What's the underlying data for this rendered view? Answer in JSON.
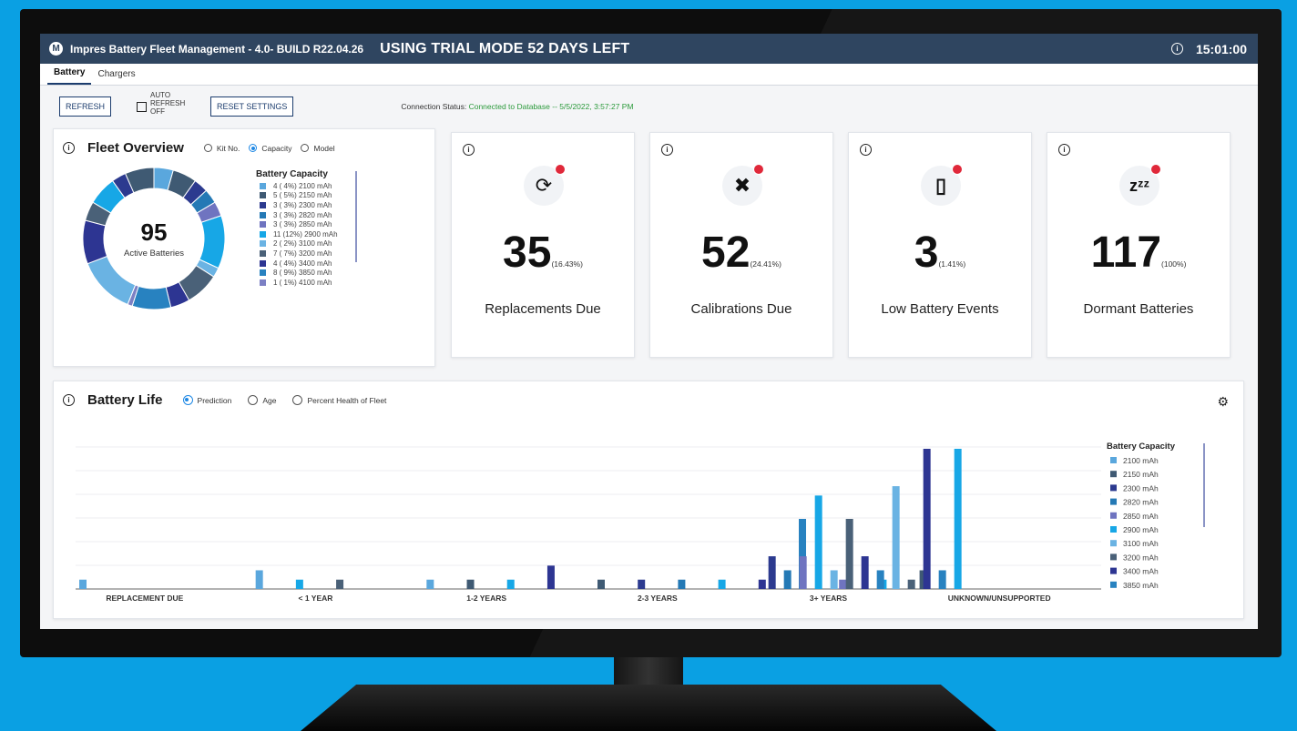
{
  "titlebar": {
    "app_title": "Impres Battery Fleet Management - 4.0- BUILD R22.04.26",
    "trial_text": "USING TRIAL MODE 52 DAYS LEFT",
    "clock": "15:01:00",
    "logo_glyph": "M"
  },
  "tabs": [
    {
      "label": "Battery",
      "active": true
    },
    {
      "label": "Chargers",
      "active": false
    }
  ],
  "toolbar": {
    "refresh_label": "REFRESH",
    "auto_refresh_label": "AUTO REFRESH",
    "auto_refresh_state": "OFF",
    "auto_refresh_checked": false,
    "reset_label": "RESET SETTINGS",
    "connection_label": "Connection Status:",
    "connection_value": "Connected to Database -- 5/5/2022, 3:57:27 PM"
  },
  "fleet_overview": {
    "title": "Fleet Overview",
    "options": [
      "Kit No.",
      "Capacity",
      "Model"
    ],
    "selected_option": "Capacity",
    "total": "95",
    "total_label": "Active Batteries",
    "legend_title": "Battery Capacity",
    "legend": [
      {
        "text": "4 (  4%) 2100 mAh",
        "count": 4,
        "color": "#5aa7dd"
      },
      {
        "text": "5 (  5%) 2150 mAh",
        "count": 5,
        "color": "#3f5a73"
      },
      {
        "text": "3 (  3%) 2300 mAh",
        "count": 3,
        "color": "#2c3a8f"
      },
      {
        "text": "3 (  3%) 2820 mAh",
        "count": 3,
        "color": "#2479b5"
      },
      {
        "text": "3 (  3%) 2850 mAh",
        "count": 3,
        "color": "#6f74c0"
      },
      {
        "text": "11 (12%) 2900 mAh",
        "count": 11,
        "color": "#17a7e6"
      },
      {
        "text": "2 (  2%) 3100 mAh",
        "count": 2,
        "color": "#6ab3e3"
      },
      {
        "text": "7 (  7%) 3200 mAh",
        "count": 7,
        "color": "#4a6178"
      },
      {
        "text": "4 (  4%) 3400 mAh",
        "count": 4,
        "color": "#2d3592"
      },
      {
        "text": "8 (  9%) 3850 mAh",
        "count": 8,
        "color": "#2882c0"
      },
      {
        "text": "1 (  1%) 4100 mAh",
        "count": 1,
        "color": "#7c80c4"
      }
    ],
    "donut_segments": [
      {
        "value": 4,
        "color": "#5aa7dd"
      },
      {
        "value": 5,
        "color": "#3f5a73"
      },
      {
        "value": 3,
        "color": "#2c3a8f"
      },
      {
        "value": 3,
        "color": "#2479b5"
      },
      {
        "value": 3,
        "color": "#6f74c0"
      },
      {
        "value": 11,
        "color": "#17a7e6"
      },
      {
        "value": 2,
        "color": "#6ab3e3"
      },
      {
        "value": 7,
        "color": "#4a6178"
      },
      {
        "value": 4,
        "color": "#2d3592"
      },
      {
        "value": 8,
        "color": "#2882c0"
      },
      {
        "value": 1,
        "color": "#7c80c4"
      },
      {
        "value": 12,
        "color": "#6ab3e3"
      },
      {
        "value": 9,
        "color": "#2d3592"
      },
      {
        "value": 4,
        "color": "#4a6178"
      },
      {
        "value": 6,
        "color": "#17a7e6"
      },
      {
        "value": 3,
        "color": "#2c3a8f"
      },
      {
        "value": 6,
        "color": "#3f5a73"
      }
    ]
  },
  "stats": [
    {
      "value": "35",
      "pct": "(16.43%)",
      "label": "Replacements Due",
      "icon": "refresh-icon",
      "glyph": "⟳"
    },
    {
      "value": "52",
      "pct": "(24.41%)",
      "label": "Calibrations Due",
      "icon": "tools-icon",
      "glyph": "✖"
    },
    {
      "value": "3",
      "pct": "(1.41%)",
      "label": "Low Battery Events",
      "icon": "battery-low-icon",
      "glyph": "▯"
    },
    {
      "value": "117",
      "pct": "(100%)",
      "label": "Dormant Batteries",
      "icon": "sleep-icon",
      "glyph": "zᶻᶻ"
    }
  ],
  "battery_life": {
    "title": "Battery Life",
    "options": [
      "Prediction",
      "Age",
      "Percent Health of Fleet"
    ],
    "selected_option": "Prediction"
  },
  "chart_data": {
    "type": "bar",
    "categories": [
      "REPLACEMENT DUE",
      "< 1 YEAR",
      "1-2 YEARS",
      "2-3 YEARS",
      "3+ YEARS",
      "UNKNOWN/UNSUPPORTED"
    ],
    "legend_title": "Battery Capacity",
    "ylim": [
      0,
      30
    ],
    "grid": true,
    "legend_placement": "right",
    "series": [
      {
        "name": "2100  mAh",
        "color": "#5aa7dd",
        "values": [
          2,
          4,
          2,
          0,
          0,
          0
        ]
      },
      {
        "name": "2150  mAh",
        "color": "#3f5a73",
        "values": [
          0,
          0,
          2,
          2,
          0,
          0
        ]
      },
      {
        "name": "2300  mAh",
        "color": "#2c3a8f",
        "values": [
          0,
          0,
          0,
          2,
          7,
          0
        ]
      },
      {
        "name": "2820  mAh",
        "color": "#2479b5",
        "values": [
          0,
          0,
          0,
          2,
          4,
          0
        ]
      },
      {
        "name": "2850  mAh",
        "color": "#6f74c0",
        "values": [
          0,
          0,
          0,
          0,
          7,
          0
        ]
      },
      {
        "name": "2900  mAh",
        "color": "#17a7e6",
        "values": [
          0,
          2,
          2,
          2,
          20,
          0
        ]
      },
      {
        "name": "3100  mAh",
        "color": "#6ab3e3",
        "values": [
          0,
          0,
          0,
          0,
          4,
          0
        ]
      },
      {
        "name": "3200  mAh",
        "color": "#4a6178",
        "values": [
          0,
          2,
          0,
          0,
          15,
          0
        ]
      },
      {
        "name": "3400  mAh",
        "color": "#2d3592",
        "values": [
          0,
          0,
          5,
          2,
          7,
          0
        ]
      },
      {
        "name": "3850  mAh",
        "color": "#2882c0",
        "values": [
          0,
          0,
          0,
          15,
          4,
          0
        ]
      }
    ],
    "extra_bars": [
      {
        "category": 3,
        "values": [
          2,
          2,
          4
        ],
        "colors": [
          "#6f74c0",
          "#17a7e6",
          "#3f5a73"
        ]
      },
      {
        "category": 4,
        "values": [
          22,
          2,
          30,
          4,
          30
        ],
        "colors": [
          "#6ab3e3",
          "#4a6178",
          "#2d3592",
          "#2882c0",
          "#17a7e6"
        ]
      }
    ]
  },
  "colors": {
    "titlebar": "#2f4560",
    "accent": "#1e88e5",
    "connection_ok": "#2b9a3b",
    "alert": "#e0283a",
    "background": "#0aa0e3"
  }
}
